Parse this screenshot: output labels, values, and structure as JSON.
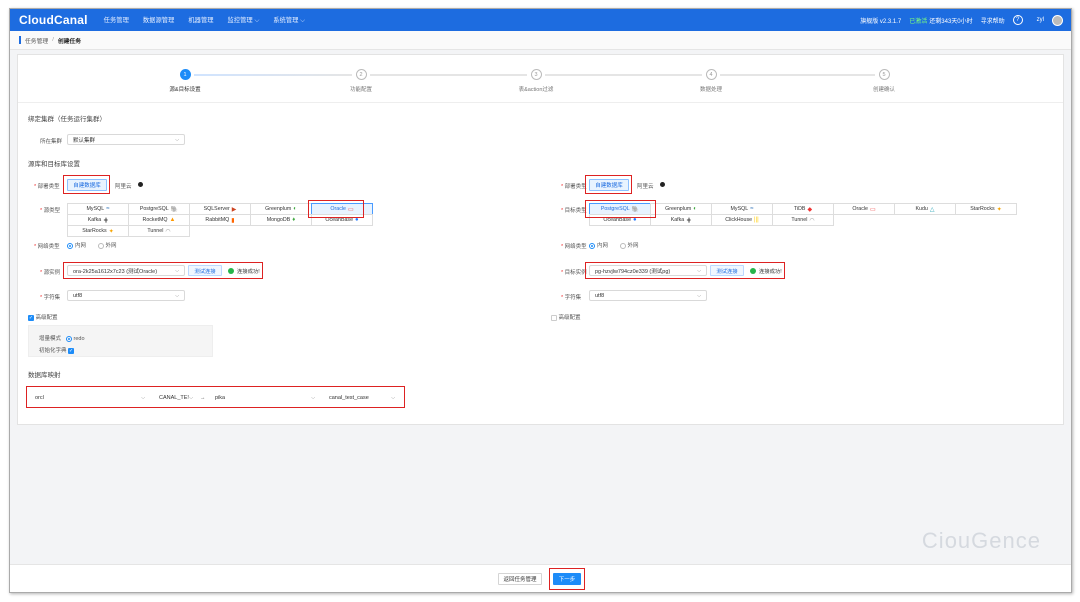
{
  "app": {
    "logo": "CloudCanal"
  },
  "nav": [
    "任务管理",
    "数据源管理",
    "机器管理",
    "监控管理 ⌵",
    "系统管理 ⌵"
  ],
  "topright": {
    "edition": "旗舰版 v2.3.1.7",
    "status": "已激活",
    "runtime": "还剩343天0小时",
    "help": "寻求帮助",
    "help_icon": "?",
    "user": "zyl"
  },
  "breadcrumb": {
    "parent": "任务管理",
    "sep": "/",
    "current": "创建任务"
  },
  "steps": [
    {
      "num": "1",
      "label": "源&目标设置"
    },
    {
      "num": "2",
      "label": "功能配置"
    },
    {
      "num": "3",
      "label": "表&action过滤"
    },
    {
      "num": "4",
      "label": "数据处理"
    },
    {
      "num": "5",
      "label": "创建确认"
    }
  ],
  "cluster": {
    "title": "绑定集群（任务运行集群）",
    "label": "所在集群",
    "value": "默认集群"
  },
  "source_target_title": "源库和目标库设置",
  "source": {
    "deploy_label": "部署类型",
    "deploy_selected": "自建数据库",
    "deploy_other": "阿里云",
    "type_label": "源类型",
    "types": [
      {
        "name": "MySQL",
        "icon": "≈"
      },
      {
        "name": "PostgreSQL",
        "icon": "🐘"
      },
      {
        "name": "SQLServer",
        "icon": "▶"
      },
      {
        "name": "Greenplum",
        "icon": "◐"
      },
      {
        "name": "Oracle",
        "icon": "▭"
      },
      {
        "name": "Kafka",
        "icon": "⋕"
      },
      {
        "name": "RocketMQ",
        "icon": "▲"
      },
      {
        "name": "RabbitMQ",
        "icon": "▮"
      },
      {
        "name": "MongoDB",
        "icon": "♦"
      },
      {
        "name": "OceanBase",
        "icon": "●"
      },
      {
        "name": "StarRocks",
        "icon": "✦"
      },
      {
        "name": "Tunnel",
        "icon": "◠"
      }
    ],
    "selected_type": "Oracle",
    "net_label": "网络类型",
    "net_inner": "内网",
    "net_outer": "外网",
    "instance_label": "源实例",
    "instance_value": "ora-2k25a1612x7c23 (测试Oracle)",
    "test_btn": "测试连接",
    "ok_text": "连接成功!",
    "charset_label": "字符集",
    "charset_value": "utf8",
    "advanced_label": "高级配置",
    "mode_label": "增量模式",
    "mode_value": "redo",
    "init_dict_label": "初始化字典"
  },
  "target": {
    "deploy_label": "部署类型",
    "deploy_selected": "自建数据库",
    "deploy_other": "阿里云",
    "type_label": "目标类型",
    "types": [
      {
        "name": "PostgreSQL",
        "icon": "🐘"
      },
      {
        "name": "Greenplum",
        "icon": "◐"
      },
      {
        "name": "MySQL",
        "icon": "≈"
      },
      {
        "name": "TiDB",
        "icon": "◆"
      },
      {
        "name": "Oracle",
        "icon": "▭"
      },
      {
        "name": "Kudu",
        "icon": "△"
      },
      {
        "name": "StarRocks",
        "icon": "✦"
      },
      {
        "name": "OceanBase",
        "icon": "●"
      },
      {
        "name": "Kafka",
        "icon": "⋕"
      },
      {
        "name": "ClickHouse",
        "icon": "|||"
      },
      {
        "name": "Tunnel",
        "icon": "◠"
      }
    ],
    "selected_type": "PostgreSQL",
    "net_label": "网络类型",
    "net_inner": "内网",
    "net_outer": "外网",
    "instance_label": "目标实例",
    "instance_value": "pg-hzvjlw794cz0e339 (测试pg)",
    "test_btn": "测试连接",
    "ok_text": "连接成功!",
    "charset_label": "字符集",
    "charset_value": "utf8",
    "advanced_label": "高级配置"
  },
  "mapping": {
    "title": "数据库映射",
    "src_db": "orcl",
    "src_schema": "CANAL_TE!",
    "arrow": "→",
    "dst_db": "pika",
    "dst_schema": "canal_test_case"
  },
  "footer": {
    "back": "返回任务管理",
    "next": "下一步"
  },
  "watermark": "CiouGence",
  "colors": {
    "primary": "#1d6ce0",
    "success": "#26b44a",
    "highlight": "#d22"
  }
}
